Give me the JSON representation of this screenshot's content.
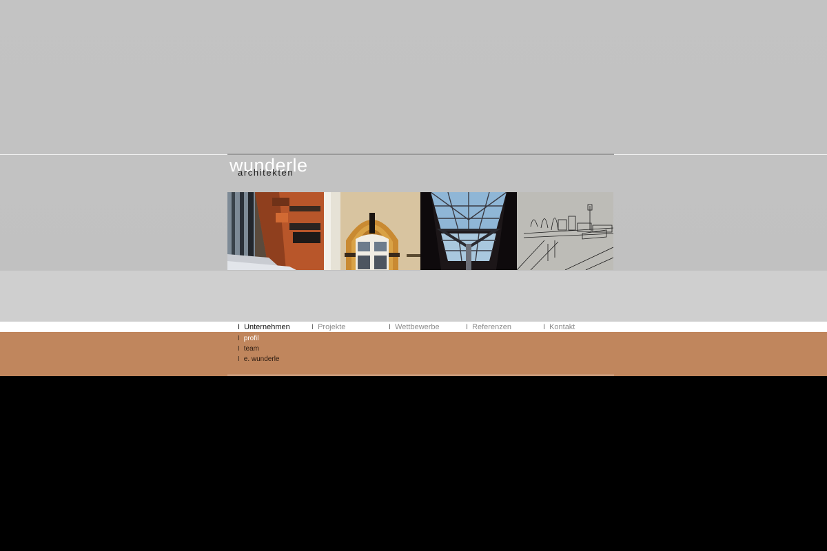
{
  "logo": {
    "main": "wunderle",
    "sub": "architekten"
  },
  "photos": [
    {
      "icon": "facade-photo"
    },
    {
      "icon": "arched-window-photo"
    },
    {
      "icon": "glass-roof-photo"
    },
    {
      "icon": "sketch-drawing"
    }
  ],
  "nav": {
    "separator": "I",
    "items": [
      {
        "label": "Unternehmen",
        "active": true
      },
      {
        "label": "Projekte",
        "active": false
      },
      {
        "label": "Wettbewerbe",
        "active": false
      },
      {
        "label": "Referenzen",
        "active": false
      },
      {
        "label": "Kontakt",
        "active": false
      }
    ]
  },
  "subnav": {
    "separator": "I",
    "items": [
      {
        "label": "profil",
        "active": true
      },
      {
        "label": "team",
        "active": false
      },
      {
        "label": "e. wunderle",
        "active": false
      }
    ]
  },
  "colors": {
    "background_top": "#c3c3c3",
    "background_mid": "#cfcfcf",
    "accent_copper": "#c0865d",
    "footer": "#000000"
  }
}
